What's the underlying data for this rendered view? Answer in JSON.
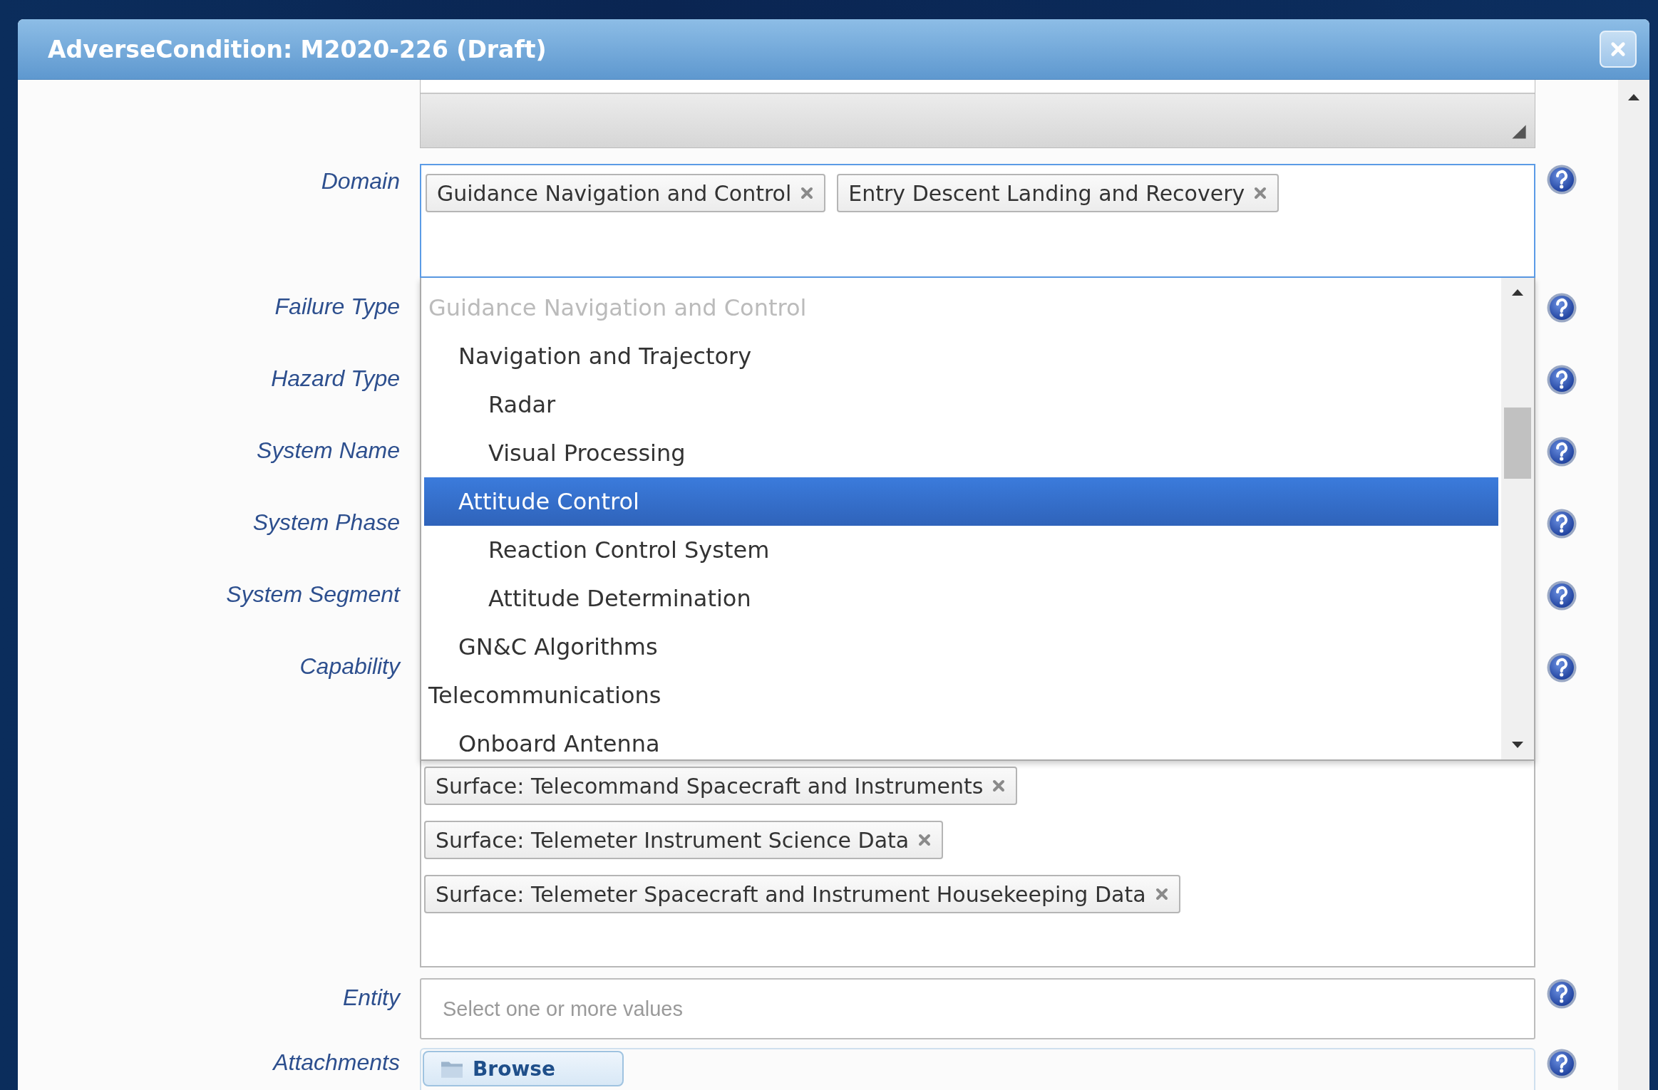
{
  "window": {
    "title": "AdverseCondition: M2020-226 (Draft)"
  },
  "form": {
    "rows": [
      {
        "kind": "textarea"
      },
      {
        "kind": "tags",
        "label": "Domain",
        "focused": true,
        "tags": [
          "Guidance Navigation and Control",
          "Entry Descent Landing and Recovery"
        ]
      },
      {
        "kind": "covered",
        "label": "Failure Type"
      },
      {
        "kind": "covered",
        "label": "Hazard Type"
      },
      {
        "kind": "covered",
        "label": "System Name"
      },
      {
        "kind": "covered",
        "label": "System Phase"
      },
      {
        "kind": "covered",
        "label": "System Segment"
      },
      {
        "kind": "covered_tags",
        "label": "Capability",
        "focused": false,
        "tags": [
          "Surface: Telecommand Spacecraft and Instruments",
          "Surface: Telemeter Instrument Science Data",
          "Surface: Telemeter Spacecraft and Instrument Housekeeping Data"
        ]
      },
      {
        "kind": "select",
        "label": "Entity",
        "placeholder": "Select one or more values"
      },
      {
        "kind": "file",
        "label": "Attachments",
        "button": "Browse"
      }
    ]
  },
  "dropdown": {
    "items": [
      {
        "label": "Guidance Navigation and Control",
        "selected": false,
        "disabled": true,
        "children": [
          {
            "label": "Navigation and Trajectory",
            "selected": false,
            "disabled": false,
            "children": [
              {
                "label": "Radar",
                "selected": false,
                "disabled": false
              },
              {
                "label": "Visual Processing",
                "selected": false,
                "disabled": false
              }
            ]
          },
          {
            "label": "Attitude Control",
            "selected": true,
            "disabled": false,
            "children": [
              {
                "label": "Reaction Control System",
                "selected": false,
                "disabled": false
              },
              {
                "label": "Attitude Determination",
                "selected": false,
                "disabled": false
              }
            ]
          },
          {
            "label": "GN&C Algorithms",
            "selected": false,
            "disabled": false
          }
        ]
      },
      {
        "label": "Telecommunications",
        "selected": false,
        "disabled": false,
        "children": [
          {
            "label": "Onboard Antenna",
            "selected": false,
            "disabled": false
          }
        ]
      }
    ]
  }
}
